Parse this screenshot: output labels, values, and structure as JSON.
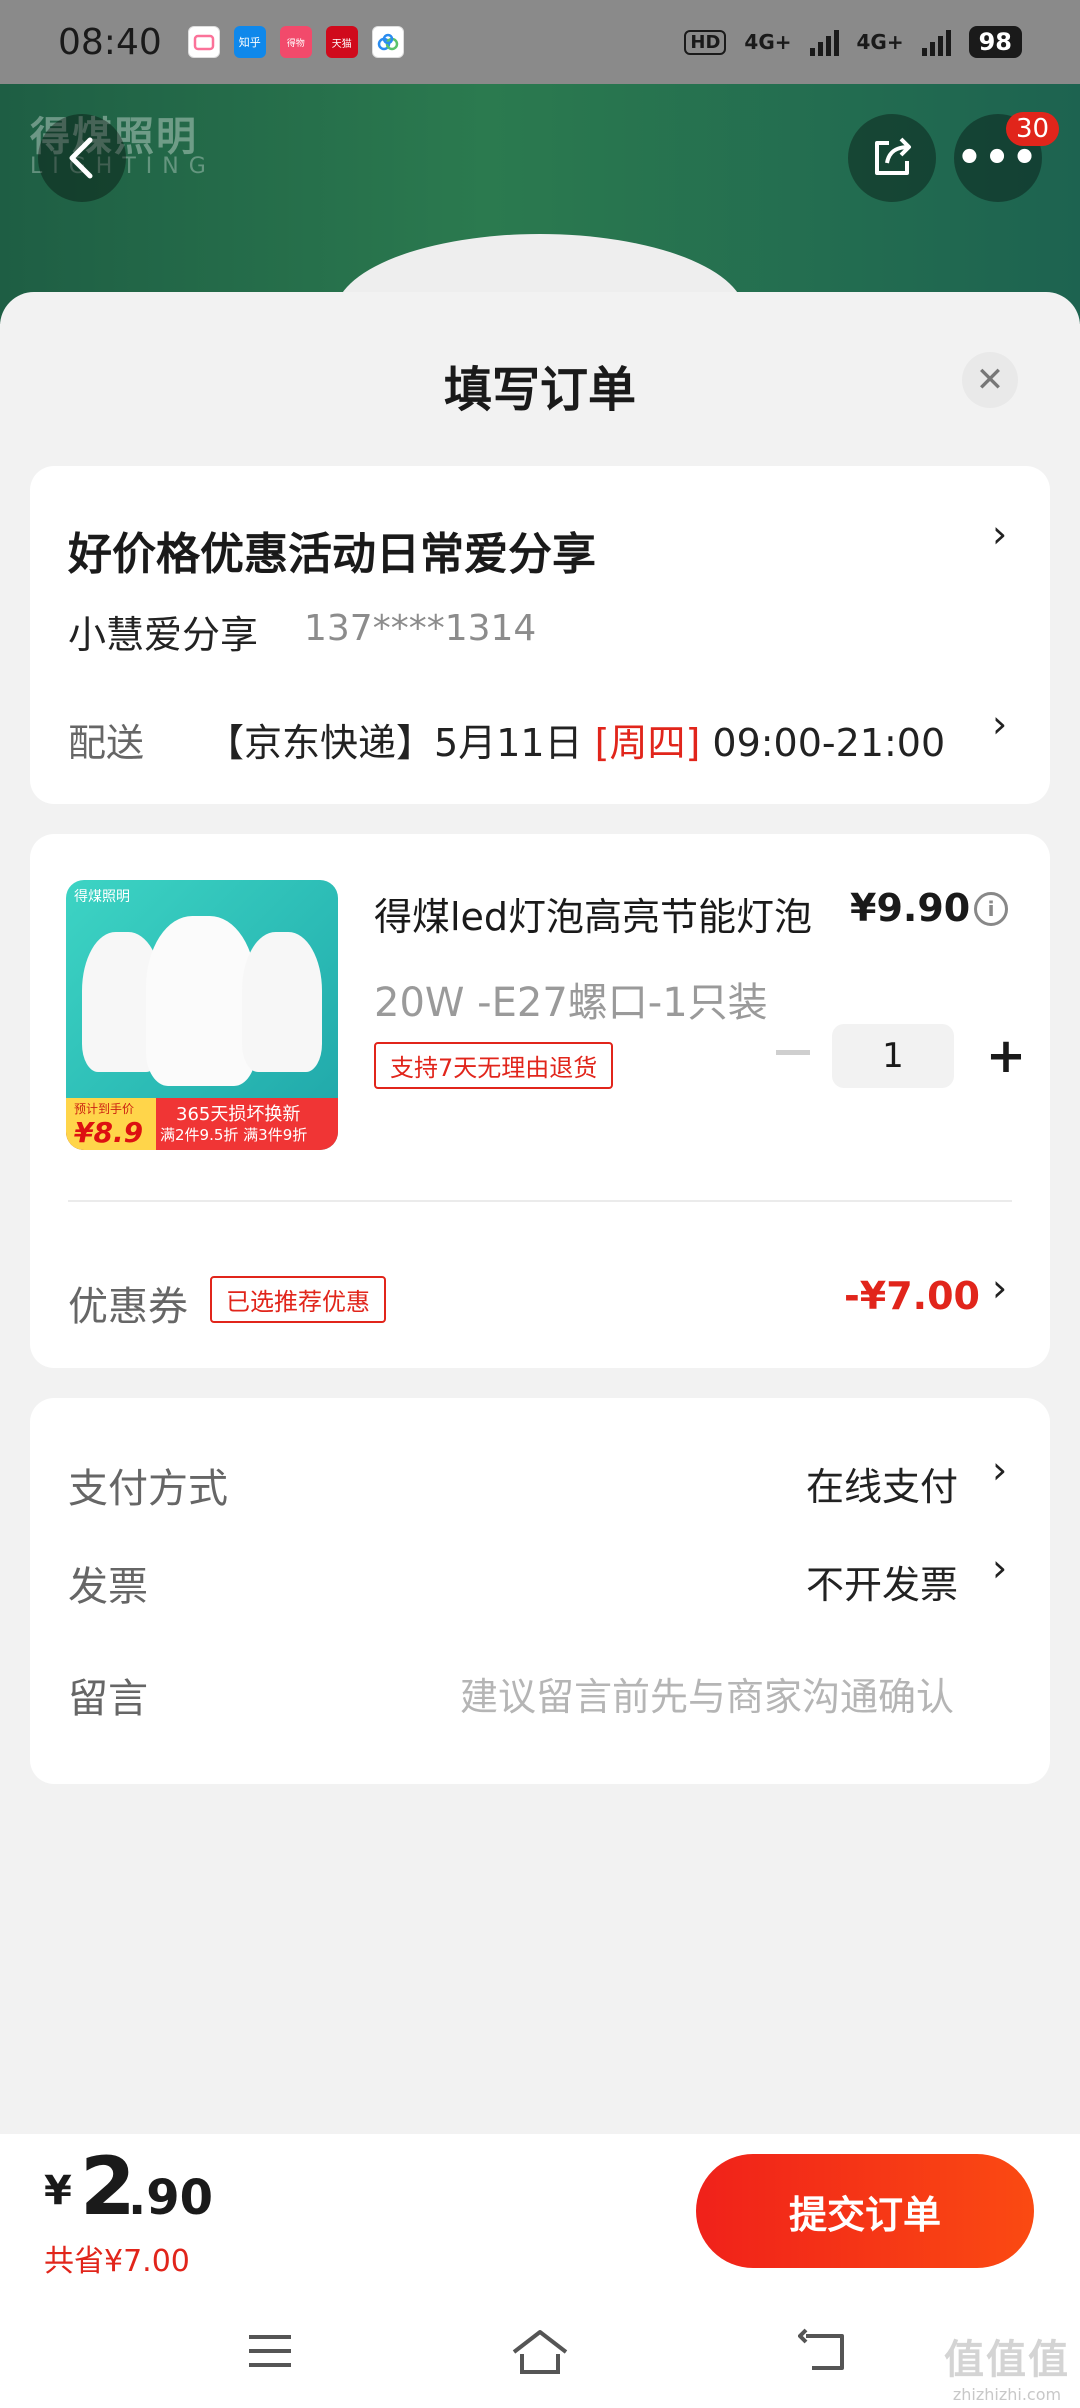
{
  "status_bar": {
    "time": "08:40",
    "app_icons": [
      "bilibili",
      "知乎",
      "得物",
      "天猫",
      "baidu-netdisk"
    ],
    "network_1": "4G+",
    "network_2": "4G+",
    "battery": "98"
  },
  "background": {
    "brand_watermark": "得煤照明",
    "brand_watermark_sub": "LIGHTING",
    "notification_count": "30"
  },
  "sheet": {
    "title": "填写订单"
  },
  "address": {
    "title": "好价格优惠活动日常爱分享",
    "name": "小慧爱分享",
    "phone": "137****1314",
    "shipping_label": "配送",
    "shipping_carrier": "【京东快递】",
    "shipping_date": "5月11日",
    "shipping_weekday": "[周四]",
    "shipping_time": "09:00-21:00"
  },
  "product": {
    "thumb_brand": "得煤照明",
    "thumb_promo_small": "预计到手价",
    "thumb_promo_price": "¥8.9",
    "thumb_promo_line1": "365天损坏换新",
    "thumb_promo_line2": "满2件9.5折 满3件9折",
    "title": "得煤led灯泡高亮节能灯泡",
    "price": "¥9.90",
    "spec": "20W  -E27螺口-1只装",
    "return_tag": "支持7天无理由退货",
    "quantity": "1",
    "coupon_label": "优惠券",
    "coupon_tag": "已选推荐优惠",
    "coupon_value": "-¥7.00"
  },
  "payment": {
    "method_label": "支付方式",
    "method_value": "在线支付",
    "invoice_label": "发票",
    "invoice_value": "不开发票",
    "note_label": "留言",
    "note_placeholder": "建议留言前先与商家沟通确认"
  },
  "footer": {
    "currency": "¥",
    "total_int": "2",
    "total_dec": ".90",
    "saved": "共省¥7.00",
    "submit": "提交订单"
  },
  "watermark": {
    "big": "值值值",
    "small": "zhizhizhi.com"
  },
  "colors": {
    "accent": "#e1251b",
    "submit_gradient_start": "#f0211a",
    "submit_gradient_end": "#fb4a12"
  }
}
